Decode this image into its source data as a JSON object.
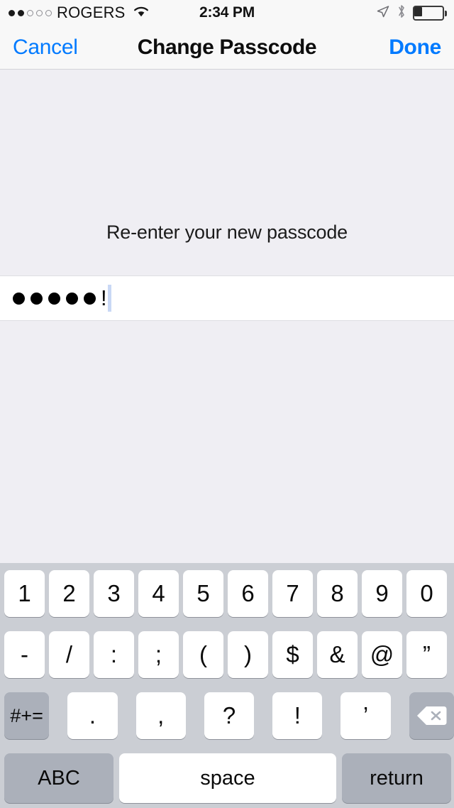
{
  "status_bar": {
    "signal_dots_filled": 2,
    "signal_dots_total": 5,
    "carrier": "ROGERS",
    "wifi_icon": "wifi-icon",
    "time": "2:34 PM",
    "location_icon": "location-arrow-icon",
    "bluetooth_icon": "bluetooth-icon",
    "battery_icon": "battery-icon",
    "battery_percent": 25
  },
  "nav_bar": {
    "cancel_label": "Cancel",
    "title": "Change Passcode",
    "done_label": "Done",
    "accent_color": "#007AFF"
  },
  "content": {
    "prompt": "Re-enter your new passcode",
    "passcode": {
      "masked_dots": 5,
      "last_char": "!",
      "caret_color": "#C9D8F5",
      "field_background": "#FFFFFF"
    },
    "background_color": "#EFEEF3"
  },
  "keyboard": {
    "background_color": "#CBCED4",
    "key_color": "#FFFFFF",
    "modifier_key_color": "#ABB0BA",
    "rows": [
      {
        "name": "numbers-row",
        "keys": [
          {
            "label": "1",
            "name": "key-1",
            "style": "white"
          },
          {
            "label": "2",
            "name": "key-2",
            "style": "white"
          },
          {
            "label": "3",
            "name": "key-3",
            "style": "white"
          },
          {
            "label": "4",
            "name": "key-4",
            "style": "white"
          },
          {
            "label": "5",
            "name": "key-5",
            "style": "white"
          },
          {
            "label": "6",
            "name": "key-6",
            "style": "white"
          },
          {
            "label": "7",
            "name": "key-7",
            "style": "white"
          },
          {
            "label": "8",
            "name": "key-8",
            "style": "white"
          },
          {
            "label": "9",
            "name": "key-9",
            "style": "white"
          },
          {
            "label": "0",
            "name": "key-0",
            "style": "white"
          }
        ]
      },
      {
        "name": "symbols-row",
        "keys": [
          {
            "label": "-",
            "name": "key-hyphen",
            "style": "white"
          },
          {
            "label": "/",
            "name": "key-slash",
            "style": "white"
          },
          {
            "label": ":",
            "name": "key-colon",
            "style": "white"
          },
          {
            "label": ";",
            "name": "key-semicolon",
            "style": "white"
          },
          {
            "label": "(",
            "name": "key-open-paren",
            "style": "white"
          },
          {
            "label": ")",
            "name": "key-close-paren",
            "style": "white"
          },
          {
            "label": "$",
            "name": "key-dollar",
            "style": "white"
          },
          {
            "label": "&",
            "name": "key-ampersand",
            "style": "white"
          },
          {
            "label": "@",
            "name": "key-at",
            "style": "white"
          },
          {
            "label": "”",
            "name": "key-quote",
            "style": "white"
          }
        ]
      },
      {
        "name": "punctuation-row",
        "keys": [
          {
            "label": "#+=",
            "name": "key-more-symbols",
            "style": "gray"
          },
          {
            "label": ".",
            "name": "key-period",
            "style": "white"
          },
          {
            "label": ",",
            "name": "key-comma",
            "style": "white"
          },
          {
            "label": "?",
            "name": "key-question",
            "style": "white"
          },
          {
            "label": "!",
            "name": "key-exclamation",
            "style": "white"
          },
          {
            "label": "’",
            "name": "key-apostrophe",
            "style": "white"
          },
          {
            "label": "",
            "name": "key-backspace",
            "style": "gray",
            "icon": "backspace-icon"
          }
        ]
      },
      {
        "name": "bottom-row",
        "keys": [
          {
            "label": "ABC",
            "name": "key-abc",
            "style": "gray"
          },
          {
            "label": "space",
            "name": "key-space",
            "style": "white"
          },
          {
            "label": "return",
            "name": "key-return",
            "style": "gray"
          }
        ]
      }
    ]
  }
}
